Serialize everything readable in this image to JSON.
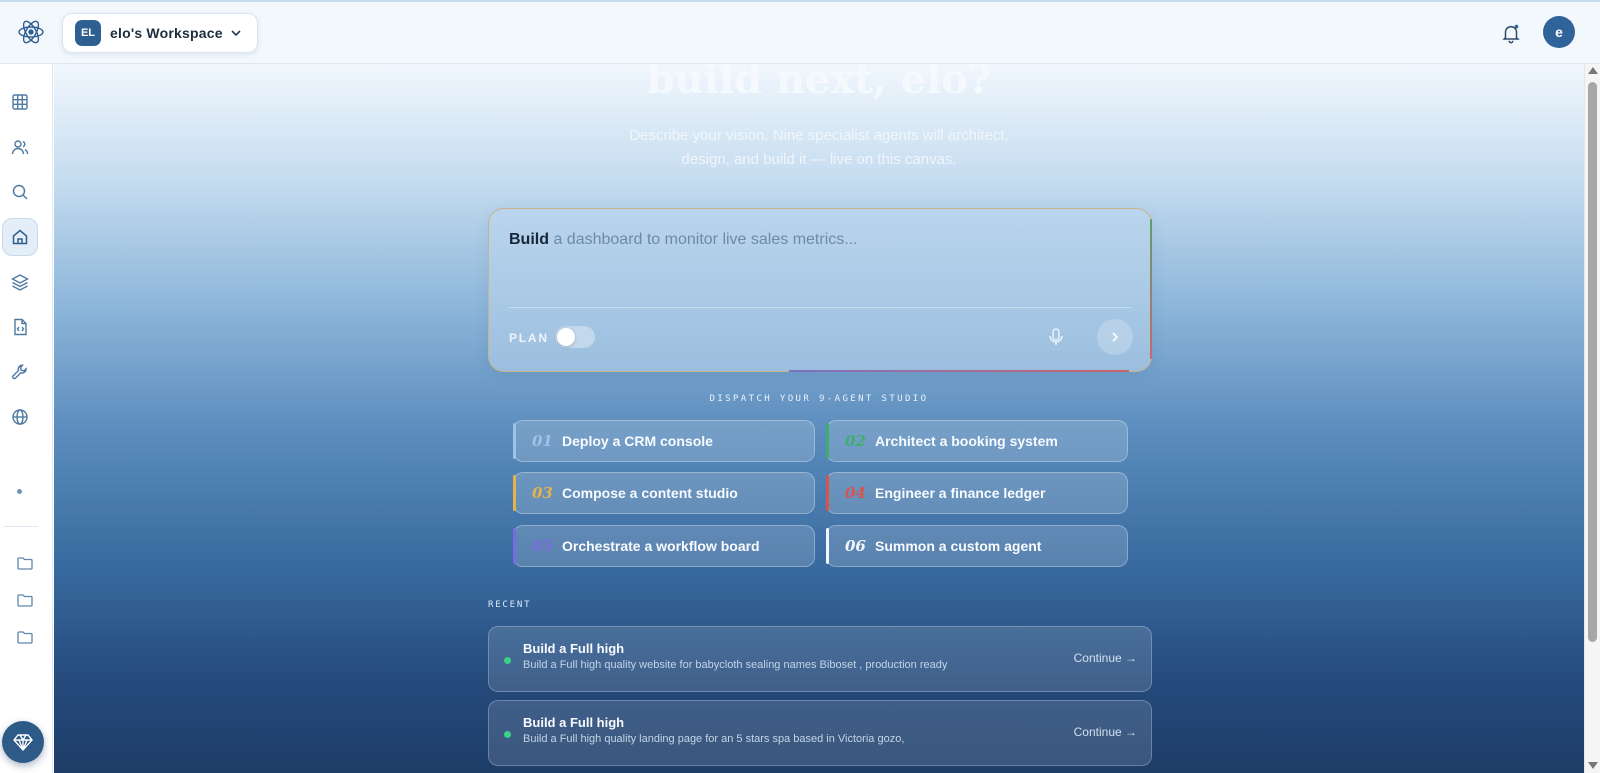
{
  "app": {
    "logo_icon": "atom-icon",
    "workspace_initials": "EL",
    "workspace_name": "elo's Workspace",
    "notifications_icon": "bell-icon",
    "user_initial": "e"
  },
  "sidebar": {
    "items": [
      {
        "name": "grid",
        "icon": "grid-icon"
      },
      {
        "name": "users",
        "icon": "users-icon"
      },
      {
        "name": "search",
        "icon": "search-icon"
      },
      {
        "name": "home",
        "icon": "home-icon",
        "active": true
      },
      {
        "name": "layers",
        "icon": "layers-icon"
      },
      {
        "name": "code-file",
        "icon": "code-file-icon"
      },
      {
        "name": "tools",
        "icon": "wrench-icon"
      },
      {
        "name": "globe",
        "icon": "globe-icon"
      }
    ],
    "folders": [
      "folder-icon",
      "folder-icon",
      "folder-icon"
    ],
    "upgrade_icon": "diamond-icon"
  },
  "hero": {
    "title": "build next, elo?",
    "subtitle": "Describe your vision. Nine specialist agents will architect, design, and build it — live on this canvas."
  },
  "prompt": {
    "keyword": "Build",
    "placeholder": "a dashboard to monitor live sales metrics...",
    "plan_label": "PLAN",
    "plan_enabled": false,
    "mic_icon": "mic-icon",
    "send_icon": "chevron-right-icon"
  },
  "dispatch": {
    "heading": "DISPATCH YOUR 9-AGENT STUDIO",
    "agents": [
      {
        "num": "01",
        "label": "Deploy a CRM console",
        "color": "#9fc3e6"
      },
      {
        "num": "02",
        "label": "Architect a booking system",
        "color": "#3fae6a"
      },
      {
        "num": "03",
        "label": "Compose a content studio",
        "color": "#e8b24a"
      },
      {
        "num": "04",
        "label": "Engineer a finance ledger",
        "color": "#d9534f"
      },
      {
        "num": "05",
        "label": "Orchestrate a workflow board",
        "color": "#7b6be0"
      },
      {
        "num": "06",
        "label": "Summon a custom agent",
        "color": "#f3f6fa"
      }
    ]
  },
  "recent": {
    "heading": "RECENT",
    "items": [
      {
        "title": "Build a Full high",
        "desc": "Build a Full high quality website for babycloth sealing names Biboset , production ready",
        "action": "Continue →"
      },
      {
        "title": "Build a Full high",
        "desc": "Build a Full high quality landing page for an 5 stars spa based in Victoria gozo,",
        "action": "Continue →"
      }
    ]
  }
}
